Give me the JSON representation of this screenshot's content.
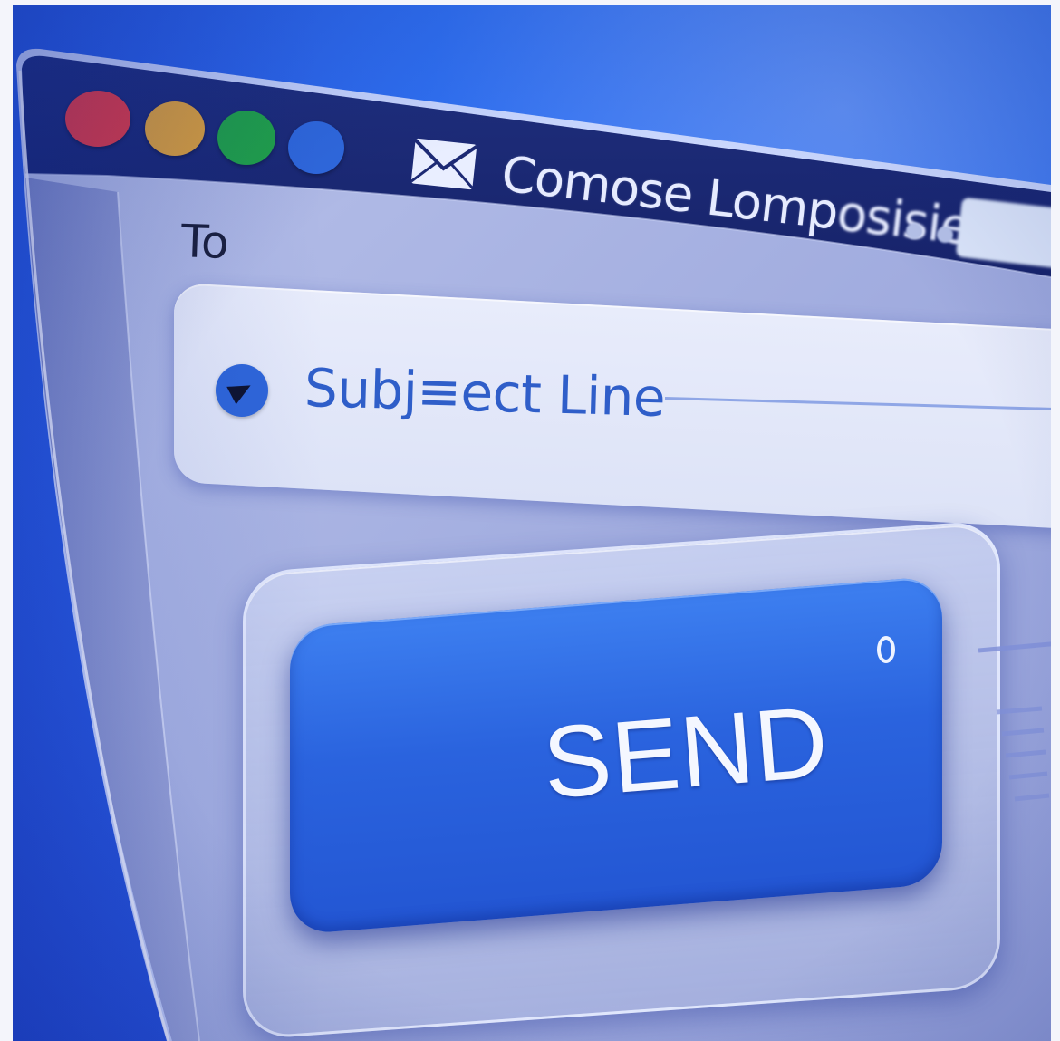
{
  "window": {
    "title": "Comose Lomposisie",
    "title_clear": "Comose Lomp",
    "title_blurred": "osisie",
    "traffic_lights": [
      {
        "name": "close",
        "color": "#e23b46"
      },
      {
        "name": "minimize",
        "color": "#e0a33a"
      },
      {
        "name": "maximize",
        "color": "#21a447"
      },
      {
        "name": "extra",
        "color": "#2f68dc"
      }
    ],
    "header_icon": "mail-envelope-icon"
  },
  "compose": {
    "to_label": "To",
    "subject_icon": "play-cursor-icon",
    "subject_value": "Subj≡ect Line"
  },
  "send": {
    "label": "SEND",
    "indicator_icon": "status-ring-icon"
  },
  "colors": {
    "accent": "#2f66d9",
    "background": "#2f6ff0",
    "send_button": "#2a63de"
  }
}
